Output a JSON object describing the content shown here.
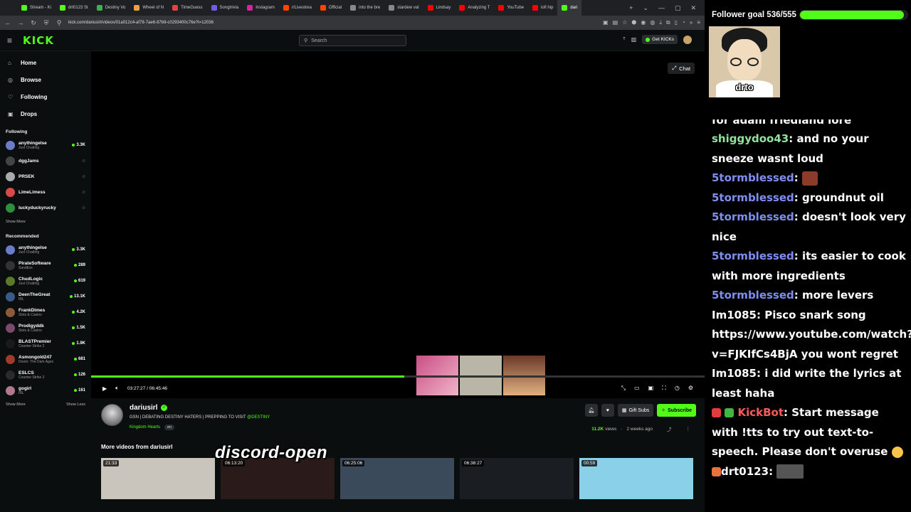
{
  "browser": {
    "tabs": [
      {
        "label": "Stream - Ki",
        "color": "#53fc18"
      },
      {
        "label": "drt0123 St",
        "color": "#53fc18"
      },
      {
        "label": "Destiny Vo",
        "color": "#3ab54a"
      },
      {
        "label": "Wheel of N",
        "color": "#e8a33d"
      },
      {
        "label": "TimeGuess",
        "color": "#e04343"
      },
      {
        "label": "Songtrivia",
        "color": "#6c5ce7"
      },
      {
        "label": "Instagram",
        "color": "#d6249f"
      },
      {
        "label": "r/Livestrea",
        "color": "#ff4500"
      },
      {
        "label": "Official",
        "color": "#ff4500"
      },
      {
        "label": "into the bre",
        "color": "#888888"
      },
      {
        "label": "stardew val",
        "color": "#888888"
      },
      {
        "label": "Lindsay",
        "color": "#ff0000"
      },
      {
        "label": "Analyzing T",
        "color": "#ff0000"
      },
      {
        "label": "YouTube",
        "color": "#ff0000"
      },
      {
        "label": "lofi hip",
        "color": "#ff0000"
      },
      {
        "label": "dari",
        "color": "#53fc18"
      }
    ],
    "url": "kick.com/dariusirl/videos/01a012c4-af78-7ae6-87b9-c0293400c76e?t=12036"
  },
  "header": {
    "logo": "KICK",
    "search_placeholder": "Search",
    "get_kicks": "Get KICKs"
  },
  "sidebar": {
    "nav": [
      {
        "label": "Home",
        "icon": "home-icon"
      },
      {
        "label": "Browse",
        "icon": "compass-icon"
      },
      {
        "label": "Following",
        "icon": "heart-icon"
      },
      {
        "label": "Drops",
        "icon": "gift-icon"
      }
    ],
    "following_title": "Following",
    "following": [
      {
        "name": "anythingelse",
        "category": "Just Chatting",
        "viewers": "3.3K",
        "live": true,
        "color": "#6b7cc9"
      },
      {
        "name": "dggJams",
        "category": "",
        "viewers": "",
        "live": false,
        "color": "#444444"
      },
      {
        "name": "PRSEK",
        "category": "",
        "viewers": "",
        "live": false,
        "color": "#aaaaaa"
      },
      {
        "name": "LimeLimess",
        "category": "",
        "viewers": "",
        "live": false,
        "color": "#d84a4a"
      },
      {
        "name": "luckyduckyrucky",
        "category": "",
        "viewers": "",
        "live": false,
        "color": "#2f8f3f"
      }
    ],
    "show_more": "Show More",
    "recommended_title": "Recommended",
    "recommended": [
      {
        "name": "anythingelse",
        "category": "Just Chatting",
        "viewers": "3.3K",
        "color": "#6b7cc9"
      },
      {
        "name": "PirateSoftware",
        "category": "Sandbox",
        "viewers": "289",
        "color": "#333333"
      },
      {
        "name": "ChudLogic",
        "category": "Just Chatting",
        "viewers": "619",
        "color": "#5a7a2a"
      },
      {
        "name": "DeenTheGreat",
        "category": "IRL",
        "viewers": "13.1K",
        "color": "#3a5a8a"
      },
      {
        "name": "FrankDimes",
        "category": "Slots & Casino",
        "viewers": "4.2K",
        "color": "#8a5a3a"
      },
      {
        "name": "Prodigyddk",
        "category": "Slots & Casino",
        "viewers": "1.5K",
        "color": "#7a4a6a"
      },
      {
        "name": "BLASTPremier",
        "category": "Counter-Strike 2",
        "viewers": "1.9K",
        "color": "#1a1a1a"
      },
      {
        "name": "Asmongold247",
        "category": "Doom: The Dark Ages",
        "viewers": "681",
        "color": "#a03a2a"
      },
      {
        "name": "ESLCS",
        "category": "Counter-Strike 2",
        "viewers": "126",
        "color": "#2a2a2a"
      },
      {
        "name": "gogirl",
        "category": "IRL",
        "viewers": "161",
        "color": "#b07a8a"
      }
    ],
    "show_less": "Show Less"
  },
  "player": {
    "chat_button": "Chat",
    "time_current": "03:27:27",
    "time_total": "06:45:46",
    "progress": 0.51
  },
  "stream": {
    "streamer": "dariusirl",
    "title_prefix": "GSN | DEBATING DESTINY HATERS | PREPPING TO VISIT ",
    "title_mention": "@DESTINY",
    "category": "Kingdom Hearts",
    "language": "en",
    "gift_subs": "Gift Subs",
    "subscribe": "Subscribe",
    "views_count": "11.2K",
    "views_label": "views",
    "age": "2 weeks ago"
  },
  "more_videos": {
    "title": "More videos from dariusirl",
    "items": [
      {
        "duration": "21:33",
        "bg": "#c9c5bd"
      },
      {
        "duration": "06:13:20",
        "bg": "#2a1a1a"
      },
      {
        "duration": "06:25:06",
        "bg": "#3a4a5a"
      },
      {
        "duration": "06:38:27",
        "bg": "#1a1d22"
      },
      {
        "duration": "00:59",
        "bg": "#8ad0e8"
      }
    ]
  },
  "overlay_text": "discord-open",
  "follower_goal": {
    "label": "Follower goal 536/555",
    "current": 536,
    "target": 555
  },
  "cam_label": "drto",
  "chat": {
    "top_clip": "for adam friedland lore",
    "messages": [
      {
        "user": "shiggydoo43",
        "ucls": "u1",
        "text": "and no your sneeze wasnt loud"
      },
      {
        "user": "5tormblessed",
        "ucls": "u2",
        "text": "",
        "emote": true
      },
      {
        "user": "5tormblessed",
        "ucls": "u2",
        "text": "groundnut oil"
      },
      {
        "user": "5tormblessed",
        "ucls": "u2",
        "text": "doesn't look very nice"
      },
      {
        "user": "5tormblessed",
        "ucls": "u2",
        "text": "its easier to cook with more ingredients"
      },
      {
        "user": "5tormblessed",
        "ucls": "u2",
        "text": "more levers"
      },
      {
        "user": "Im1085",
        "ucls": "",
        "text": "Pisco snark song https://www.youtube.com/watch?v=FJKIfCs4BjA you wont regret"
      },
      {
        "user": "Im1085",
        "ucls": "",
        "text": "i did write the lyrics at least haha"
      },
      {
        "user": "KickBot",
        "ucls": "u3",
        "text": "Start message with !tts to try out text-to-speech. Please don't overuse",
        "bot": true
      },
      {
        "user": "drt0123",
        "ucls": "",
        "text": "",
        "img": true,
        "owner": true
      }
    ]
  }
}
